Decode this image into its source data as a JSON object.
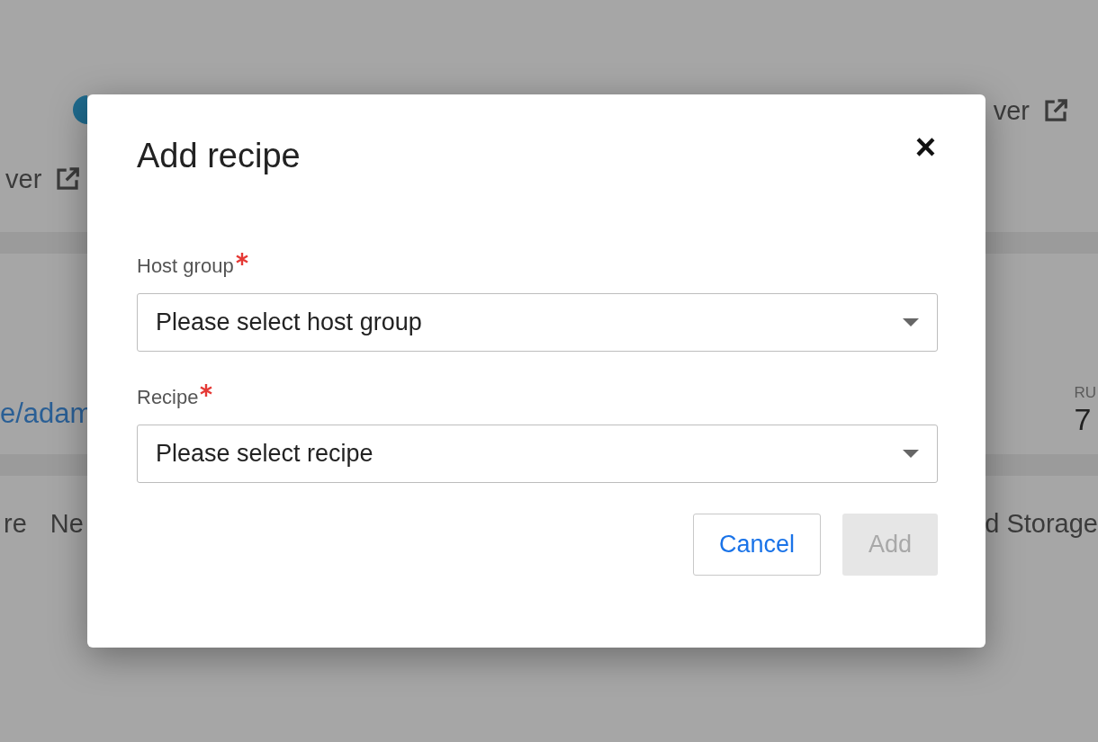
{
  "background": {
    "header": {
      "left_link": "ver",
      "right_link": "ver"
    },
    "details": {
      "left_link": "e/adam",
      "right_label": "RU",
      "right_value": "7"
    },
    "tabs": {
      "left": [
        "re",
        "Ne"
      ],
      "right": [
        "d Storage"
      ]
    }
  },
  "modal": {
    "title": "Add recipe",
    "close": "×",
    "fields": [
      {
        "label": "Host group",
        "required": true,
        "placeholder": "Please select host group"
      },
      {
        "label": "Recipe",
        "required": true,
        "placeholder": "Please select recipe"
      }
    ],
    "buttons": [
      {
        "label": "Cancel",
        "kind": "secondary",
        "disabled": false
      },
      {
        "label": "Add",
        "kind": "primary",
        "disabled": true
      }
    ]
  }
}
